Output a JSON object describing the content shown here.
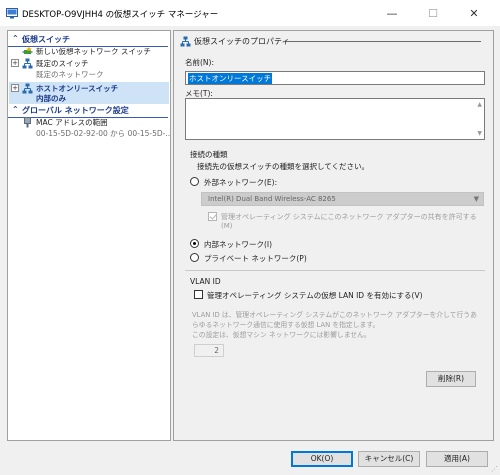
{
  "window": {
    "title": "DESKTOP-O9VJHH4 の仮想スイッチ マネージャー",
    "minimize": "—",
    "maximize": "☐",
    "close": "✕"
  },
  "tree": {
    "virtual_switch_header": "仮想スイッチ",
    "new_switch": "新しい仮想ネットワーク スイッチ",
    "default_switch": "既定のスイッチ",
    "default_switch_sub": "既定のネットワーク",
    "host_only_switch": "ホストオンリースイッチ",
    "host_only_switch_sub": "内部のみ",
    "global_header": "グローバル ネットワーク設定",
    "mac_range": "MAC アドレスの範囲",
    "mac_range_sub": "00-15-5D-02-92-00 から 00-15-5D-...",
    "collapse_glyph": "⌃",
    "expand_glyph": "+"
  },
  "props": {
    "header": "仮想スイッチのプロパティ",
    "name_label": "名前(N):",
    "name_value": "ホストオンリースイッチ",
    "memo_label": "メモ(T):",
    "conn_type_title": "接続の種類",
    "conn_type_desc": "接続先の仮想スイッチの種類を選択してください。",
    "external_label": "外部ネットワーク(E):",
    "adapter_value": "Intel(R) Dual Band Wireless-AC 8265",
    "share_label_1": "管理オペレーティング システムにこのネットワーク アダプターの共有を許可する",
    "share_label_2": "(M)",
    "internal_label": "内部ネットワーク(I)",
    "private_label": "プライベート ネットワーク(P)",
    "vlan_title": "VLAN ID",
    "vlan_check_label": "管理オペレーティング システムの仮想 LAN ID を有効にする(V)",
    "vlan_desc_1": "VLAN ID は、管理オペレーティング システムがこのネットワーク アダプターを介して行うあ",
    "vlan_desc_2": "らゆるネットワーク通信に使用する仮想 LAN を指定します。",
    "vlan_desc_3": "この設定は、仮想マシン ネットワークには影響しません。",
    "vlan_value": "2",
    "delete_button": "削除(R)"
  },
  "footer": {
    "ok": "OK(O)",
    "cancel": "キャンセル(C)",
    "apply": "適用(A)"
  },
  "colors": {
    "accent": "#0078d7",
    "header_text": "#1a3a8a",
    "selection": "#cfe3f7"
  }
}
